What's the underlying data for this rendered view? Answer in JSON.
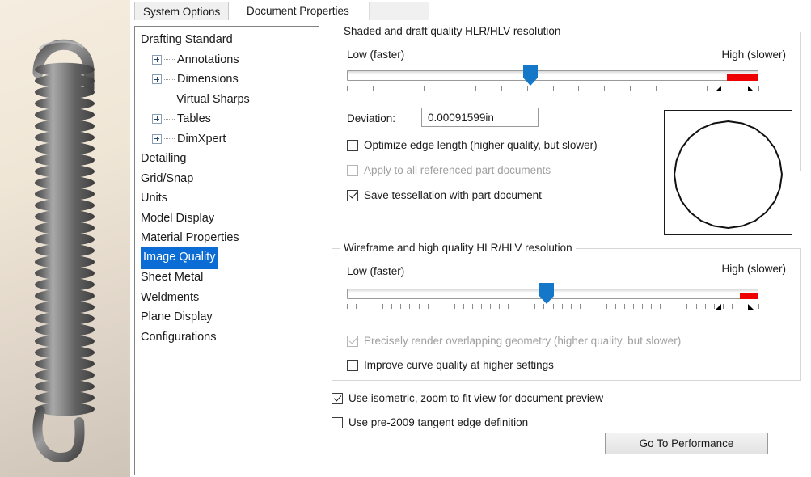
{
  "tabs": [
    {
      "label": "System Options",
      "selected": false
    },
    {
      "label": "Document Properties",
      "selected": true
    }
  ],
  "tree": {
    "items": [
      {
        "label": "Drafting Standard",
        "level": 0,
        "expander": false,
        "selected": false
      },
      {
        "label": "Annotations",
        "level": 1,
        "expander": true,
        "selected": false
      },
      {
        "label": "Dimensions",
        "level": 1,
        "expander": true,
        "selected": false
      },
      {
        "label": "Virtual Sharps",
        "level": 1,
        "expander": false,
        "selected": false
      },
      {
        "label": "Tables",
        "level": 1,
        "expander": true,
        "selected": false
      },
      {
        "label": "DimXpert",
        "level": 1,
        "expander": true,
        "selected": false
      },
      {
        "label": "Detailing",
        "level": 0,
        "expander": false,
        "selected": false
      },
      {
        "label": "Grid/Snap",
        "level": 0,
        "expander": false,
        "selected": false
      },
      {
        "label": "Units",
        "level": 0,
        "expander": false,
        "selected": false
      },
      {
        "label": "Model Display",
        "level": 0,
        "expander": false,
        "selected": false
      },
      {
        "label": "Material Properties",
        "level": 0,
        "expander": false,
        "selected": false
      },
      {
        "label": "Image Quality",
        "level": 0,
        "expander": false,
        "selected": true
      },
      {
        "label": "Sheet Metal",
        "level": 0,
        "expander": false,
        "selected": false
      },
      {
        "label": "Weldments",
        "level": 0,
        "expander": false,
        "selected": false
      },
      {
        "label": "Plane Display",
        "level": 0,
        "expander": false,
        "selected": false
      },
      {
        "label": "Configurations",
        "level": 0,
        "expander": false,
        "selected": false
      }
    ]
  },
  "shaded_group": {
    "title": "Shaded and draft quality HLR/HLV resolution",
    "slider": {
      "low_label": "Low (faster)",
      "high_label": "High (slower)",
      "position_percent": 45,
      "tick_count": 17,
      "red_zone_start_percent": 92
    },
    "deviation": {
      "label": "Deviation:",
      "value": "0.00091599in"
    },
    "checkboxes": [
      {
        "label": "Optimize edge length (higher quality, but slower)",
        "checked": false,
        "enabled": true
      },
      {
        "label": "Apply to all referenced part documents",
        "checked": false,
        "enabled": false
      },
      {
        "label": "Save tessellation with part document",
        "checked": true,
        "enabled": true
      }
    ]
  },
  "wireframe_group": {
    "title": "Wireframe and high quality HLR/HLV resolution",
    "slider": {
      "low_label": "Low (faster)",
      "high_label": "High (slower)",
      "position_percent": 49,
      "tick_count": 47,
      "red_zone_start_percent": 95
    },
    "checkboxes": [
      {
        "label": "Precisely render overlapping geometry (higher quality, but slower)",
        "checked": true,
        "enabled": false
      },
      {
        "label": "Improve curve quality at higher settings",
        "checked": false,
        "enabled": true
      }
    ]
  },
  "bottom": {
    "checkboxes": [
      {
        "label": "Use isometric, zoom to fit view for document preview",
        "checked": true,
        "enabled": true
      },
      {
        "label": "Use pre-2009 tangent edge definition",
        "checked": false,
        "enabled": true
      }
    ],
    "button_label": "Go To Performance"
  },
  "colors": {
    "accent_blue": "#0a6cd4",
    "slider_thumb": "#1477c8",
    "slider_red": "#ee0000",
    "preview_bg_top": "#f5ede0",
    "preview_bg_bottom": "#cfc4b8"
  },
  "preview": {
    "model_name": "extension-spring",
    "tessellation_shape": "faceted-circle"
  }
}
